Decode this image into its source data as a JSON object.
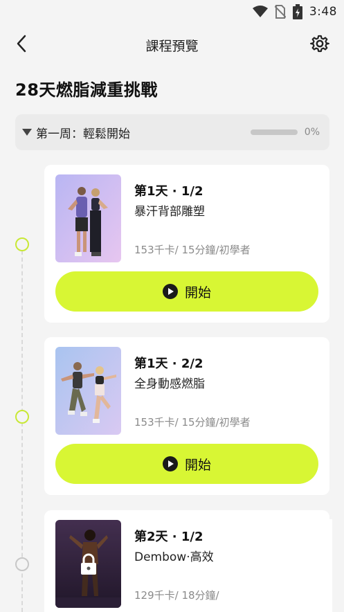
{
  "status_bar": {
    "time": "3:48",
    "icons": [
      "wifi-icon",
      "no-sim-icon",
      "battery-charging-icon"
    ]
  },
  "app_bar": {
    "title": "課程預覽",
    "back_icon": "chevron-left-icon",
    "settings_icon": "gear-icon"
  },
  "program": {
    "title": "28天燃脂減重挑戰"
  },
  "week": {
    "label": "第一周：輕鬆開始",
    "progress_percent": 0,
    "progress_text": "0%"
  },
  "workouts": [
    {
      "day_title": "第1天 · 1/2",
      "name": "暴汗背部雕塑",
      "meta": "153千卡/ 15分鐘/初學者",
      "button_label": "開始",
      "status": "active"
    },
    {
      "day_title": "第1天 · 2/2",
      "name": "全身動感燃脂",
      "meta": "153千卡/ 15分鐘/初學者",
      "button_label": "開始",
      "status": "active"
    },
    {
      "day_title": "第2天 · 1/2",
      "name": "Dembow·高效",
      "meta": "129千卡/ 18分鐘/",
      "status": "locked"
    }
  ],
  "colors": {
    "accent": "#d8f634",
    "timeline_active": "#c8e835",
    "timeline_locked": "#c7c7c7"
  }
}
